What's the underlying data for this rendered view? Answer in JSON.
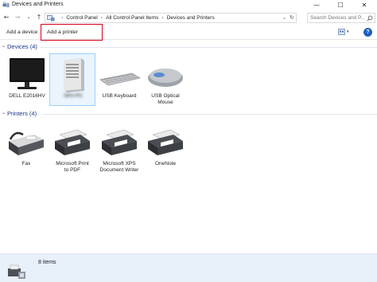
{
  "window": {
    "title": "Devices and Printers",
    "controls": {
      "minimize": "—",
      "maximize": "☐",
      "close": "✕"
    }
  },
  "navigation": {
    "back": "←",
    "forward": "→",
    "recent": "⌄",
    "up": "↑"
  },
  "address": {
    "separator": "›",
    "breadcrumbs": [
      "Control Panel",
      "All Control Panel Items",
      "Devices and Printers"
    ],
    "dropdown": "⌄",
    "refresh": "↻"
  },
  "search": {
    "placeholder": "Search Devices and P..."
  },
  "toolbar": {
    "add_device": "Add a device",
    "add_printer": "Add a printer",
    "help": "?",
    "view_dropdown": "▾"
  },
  "groups": {
    "devices": {
      "title": "Devices (4)",
      "chevron": "⌄"
    },
    "printers": {
      "title": "Printers (4)",
      "chevron": "⌄"
    }
  },
  "devices": [
    {
      "label": "DELL E2016HV",
      "icon": "monitor-icon"
    },
    {
      "label": "SRV-PC",
      "icon": "computer-tower-icon",
      "selected": true,
      "obscured": true
    },
    {
      "label": "USB Keyboard",
      "icon": "keyboard-icon"
    },
    {
      "label": "USB Optical Mouse",
      "label_lines": [
        "USB Optical",
        "Mouse"
      ],
      "icon": "mouse-icon"
    }
  ],
  "printers": [
    {
      "label": "Fax",
      "label_lines": [
        "Fax"
      ],
      "icon": "fax-icon"
    },
    {
      "label": "Microsoft Print to PDF",
      "label_lines": [
        "Microsoft Print",
        "to PDF"
      ],
      "icon": "printer-icon"
    },
    {
      "label": "Microsoft XPS Document Writer",
      "label_lines": [
        "Microsoft XPS",
        "Document Writer"
      ],
      "icon": "printer-icon"
    },
    {
      "label": "OneNote",
      "label_lines": [
        "OneNote"
      ],
      "icon": "printer-icon"
    }
  ],
  "status": {
    "count": "8 items",
    "icon": "devices-printers-icon"
  },
  "colors": {
    "accent": "#1e3287",
    "highlight": "#d9001b",
    "selection": "#99d1ff",
    "status_bg": "#e8f0fa"
  }
}
